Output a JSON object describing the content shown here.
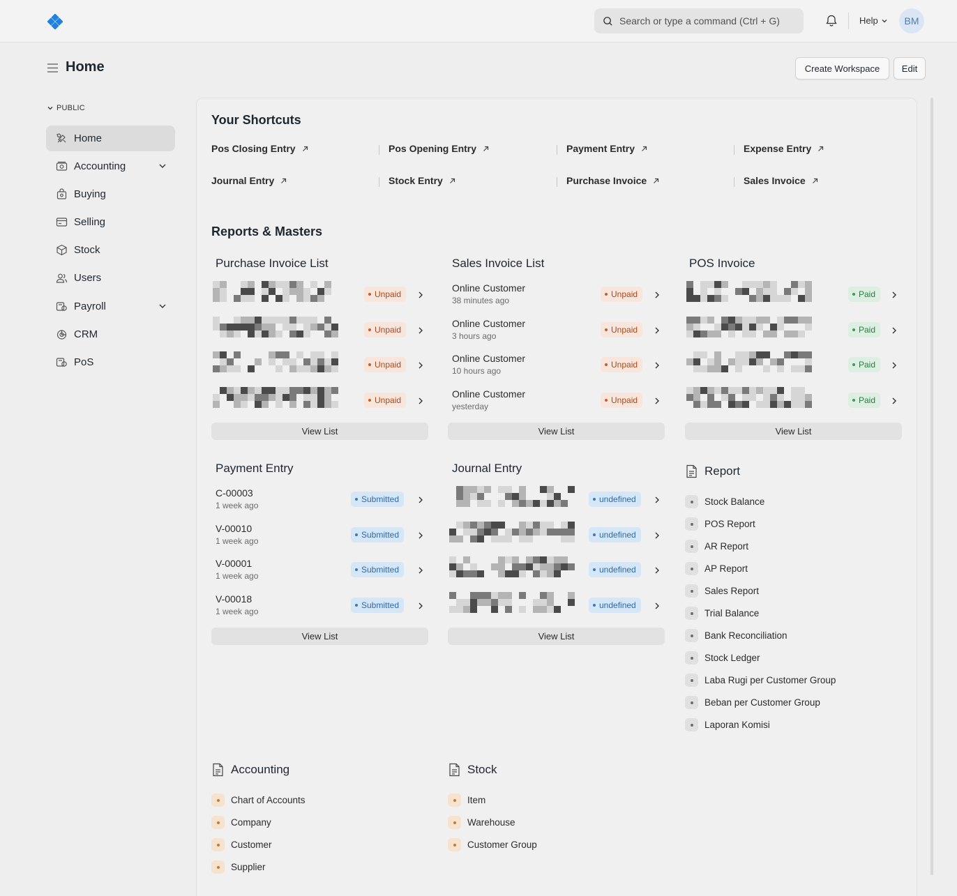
{
  "navbar": {
    "search_placeholder": "Search or type a command (Ctrl + G)",
    "help_label": "Help",
    "avatar_initials": "BM",
    "brand_color": "#1f82e0"
  },
  "page": {
    "title": "Home",
    "create_workspace_label": "Create Workspace",
    "edit_label": "Edit"
  },
  "sidebar": {
    "section_label": "PUBLIC",
    "items": [
      {
        "label": "Home",
        "icon": "tools-icon"
      },
      {
        "label": "Accounting",
        "icon": "money-icon"
      },
      {
        "label": "Buying",
        "icon": "bag-icon"
      },
      {
        "label": "Selling",
        "icon": "card-icon"
      },
      {
        "label": "Stock",
        "icon": "box-icon"
      },
      {
        "label": "Users",
        "icon": "users-icon"
      },
      {
        "label": "Payroll",
        "icon": "coins-icon"
      },
      {
        "label": "CRM",
        "icon": "pie-icon"
      },
      {
        "label": "PoS",
        "icon": "coins-icon"
      }
    ]
  },
  "shortcuts": {
    "title": "Your Shortcuts",
    "items": [
      "Pos Closing Entry",
      "Pos Opening Entry",
      "Payment Entry",
      "Expense Entry",
      "Journal Entry",
      "Stock Entry",
      "Purchase Invoice",
      "Sales Invoice"
    ]
  },
  "reports": {
    "title": "Reports & Masters",
    "view_list_label": "View List",
    "purchase_invoice": {
      "title": "Purchase Invoice List",
      "rows": [
        {
          "status": "Unpaid"
        },
        {
          "status": "Unpaid"
        },
        {
          "status": "Unpaid"
        },
        {
          "status": "Unpaid"
        }
      ]
    },
    "sales_invoice": {
      "title": "Sales Invoice List",
      "rows": [
        {
          "name": "Online Customer",
          "time": "38 minutes ago",
          "status": "Unpaid"
        },
        {
          "name": "Online Customer",
          "time": "3 hours ago",
          "status": "Unpaid"
        },
        {
          "name": "Online Customer",
          "time": "10 hours ago",
          "status": "Unpaid"
        },
        {
          "name": "Online Customer",
          "time": "yesterday",
          "status": "Unpaid"
        }
      ]
    },
    "pos_invoice": {
      "title": "POS Invoice",
      "rows": [
        {
          "status": "Paid"
        },
        {
          "status": "Paid"
        },
        {
          "status": "Paid"
        },
        {
          "status": "Paid"
        }
      ]
    },
    "payment_entry": {
      "title": "Payment Entry",
      "rows": [
        {
          "name": "C-00003",
          "time": "1 week ago",
          "status": "Submitted"
        },
        {
          "name": "V-00010",
          "time": "1 week ago",
          "status": "Submitted"
        },
        {
          "name": "V-00001",
          "time": "1 week ago",
          "status": "Submitted"
        },
        {
          "name": "V-00018",
          "time": "1 week ago",
          "status": "Submitted"
        }
      ]
    },
    "journal_entry": {
      "title": "Journal Entry",
      "rows": [
        {
          "status": "undefined"
        },
        {
          "status": "undefined"
        },
        {
          "status": "undefined"
        },
        {
          "status": "undefined"
        }
      ]
    }
  },
  "cards": {
    "report": {
      "title": "Report",
      "links": [
        "Stock Balance",
        "POS Report",
        "AR Report",
        "AP Report",
        "Sales Report",
        "Trial Balance",
        "Bank Reconciliation",
        "Stock Ledger",
        "Laba Rugi per Customer Group",
        "Beban per Customer Group",
        "Laporan Komisi"
      ]
    },
    "accounting": {
      "title": "Accounting",
      "links": [
        "Chart of Accounts",
        "Company",
        "Customer",
        "Supplier"
      ]
    },
    "stock": {
      "title": "Stock",
      "links": [
        "Item",
        "Warehouse",
        "Customer Group"
      ]
    }
  }
}
